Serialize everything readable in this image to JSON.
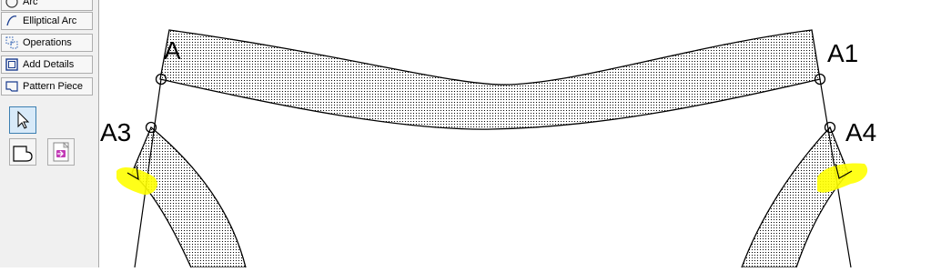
{
  "toolbar": {
    "buttons": [
      {
        "label": "Arc",
        "icon": "arc-icon"
      },
      {
        "label": "Elliptical Arc",
        "icon": "elliptical-arc-icon"
      },
      {
        "label": "Operations",
        "icon": "operations-icon"
      },
      {
        "label": "Add Details",
        "icon": "add-details-icon"
      },
      {
        "label": "Pattern Piece",
        "icon": "pattern-piece-icon"
      }
    ],
    "tools": [
      {
        "icon": "arrow-pointer-icon",
        "state": "active"
      },
      {
        "icon": "piece-node-icon",
        "state": "normal"
      },
      {
        "icon": "export-layout-icon",
        "state": "normal"
      }
    ]
  },
  "canvas": {
    "points": {
      "A": "A",
      "A1": "A1",
      "A3": "A3",
      "A4": "A4"
    },
    "colors": {
      "outline": "#000000",
      "highlight": "#ffff00",
      "fill_dots": "#000000"
    }
  }
}
